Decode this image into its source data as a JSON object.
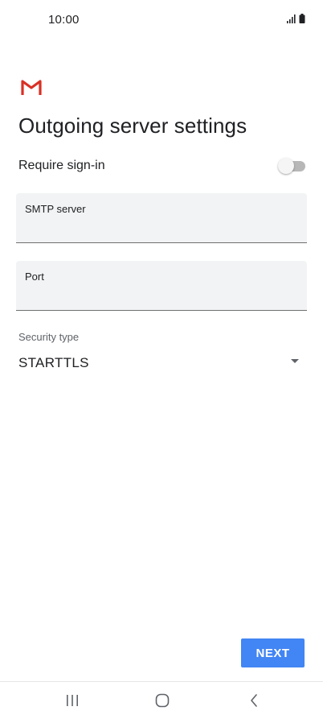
{
  "status_bar": {
    "time": "10:00",
    "icons": [
      "signal-icon",
      "battery-icon"
    ]
  },
  "app": {
    "logo": "gmail-logo",
    "logo_colors": [
      "#d93025",
      "#c5221f"
    ]
  },
  "page": {
    "title": "Outgoing server settings"
  },
  "require_signin": {
    "label": "Require sign-in",
    "enabled": false
  },
  "smtp_server": {
    "label": "SMTP server",
    "value": ""
  },
  "port": {
    "label": "Port",
    "value": ""
  },
  "security": {
    "label": "Security type",
    "selected": "STARTTLS"
  },
  "actions": {
    "next_label": "NEXT"
  },
  "nav_bar": {
    "items": [
      "recents-icon",
      "home-icon",
      "back-icon"
    ]
  },
  "colors": {
    "accent": "#4285f4",
    "field_background": "#f1f3f4",
    "text": "#202124"
  }
}
